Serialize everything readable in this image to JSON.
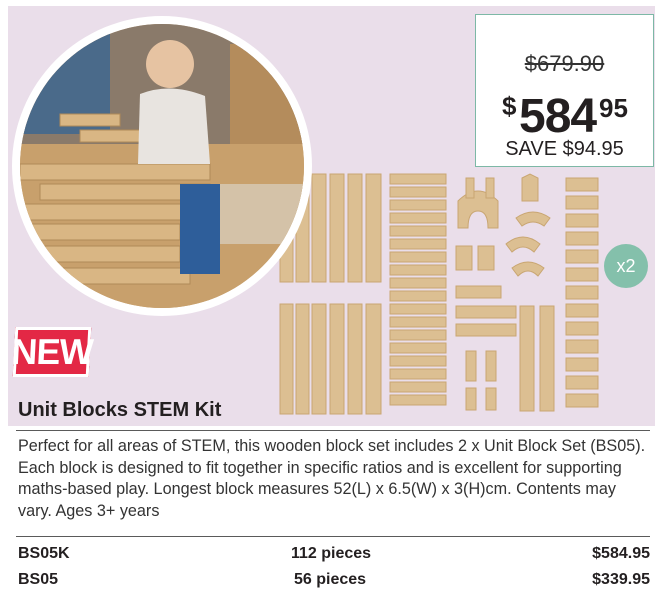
{
  "product": {
    "badge": "NEW",
    "title": "Unit Blocks STEM Kit",
    "description": "Perfect for all areas of STEM, this wooden block set includes 2 x Unit Block Set (BS05). Each block is designed to fit together in specific ratios and is excellent for supporting maths-based play. Longest block measures 52(L) x 6.5(W) x 3(H)cm. Contents may vary. Ages 3+ years",
    "quantity_badge": "x2"
  },
  "price": {
    "old": "$679.90",
    "currency_symbol": "$",
    "main": "584",
    "cents": "95",
    "save": "SAVE $94.95"
  },
  "variants": [
    {
      "code": "BS05K",
      "qty": "112 pieces",
      "price": "$584.95"
    },
    {
      "code": "BS05",
      "qty": "56 pieces",
      "price": "$339.95"
    }
  ],
  "colors": {
    "panel": "#eadeea",
    "badge_red": "#e32845",
    "teal": "#84c0ab",
    "wood": "#d9b98a"
  }
}
